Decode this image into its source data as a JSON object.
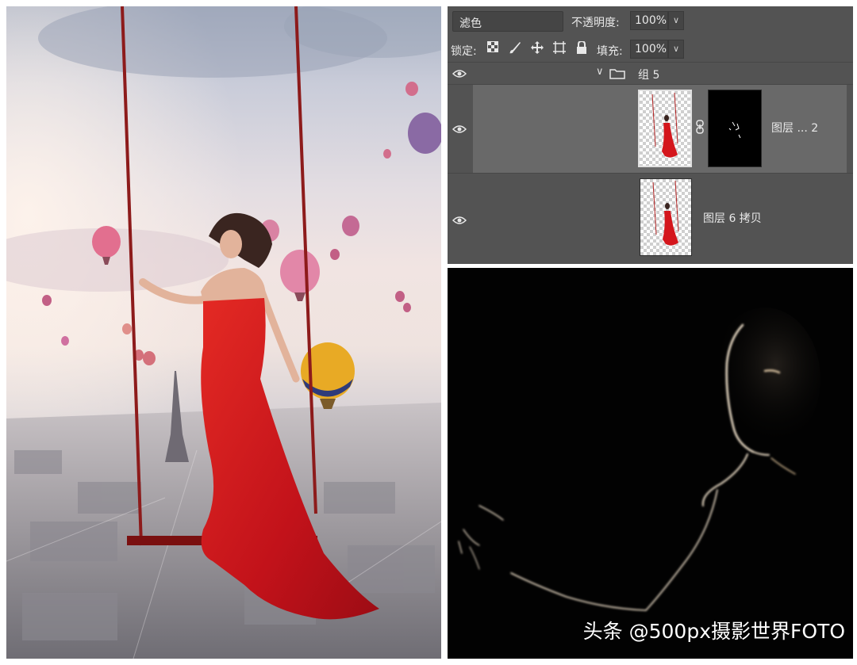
{
  "photo": {
    "alt_subject": "woman-in-red-dress-on-swing"
  },
  "layers_panel": {
    "blend_mode": "滤色",
    "opacity_label": "不透明度:",
    "opacity_value": "100%",
    "lock_label": "锁定:",
    "fill_label": "填充:",
    "fill_value": "100%",
    "group": {
      "name": "组 5"
    },
    "layers": [
      {
        "name": "图层 ... 2",
        "selected": true,
        "has_mask": true
      },
      {
        "name": "图层 6 拷贝",
        "selected": false,
        "has_mask": false
      }
    ]
  },
  "watermark": "头条 @500px摄影世界FOTO",
  "colors": {
    "panel_bg": "#535353",
    "selected_row": "#696969",
    "dress_red": "#d4161c"
  }
}
